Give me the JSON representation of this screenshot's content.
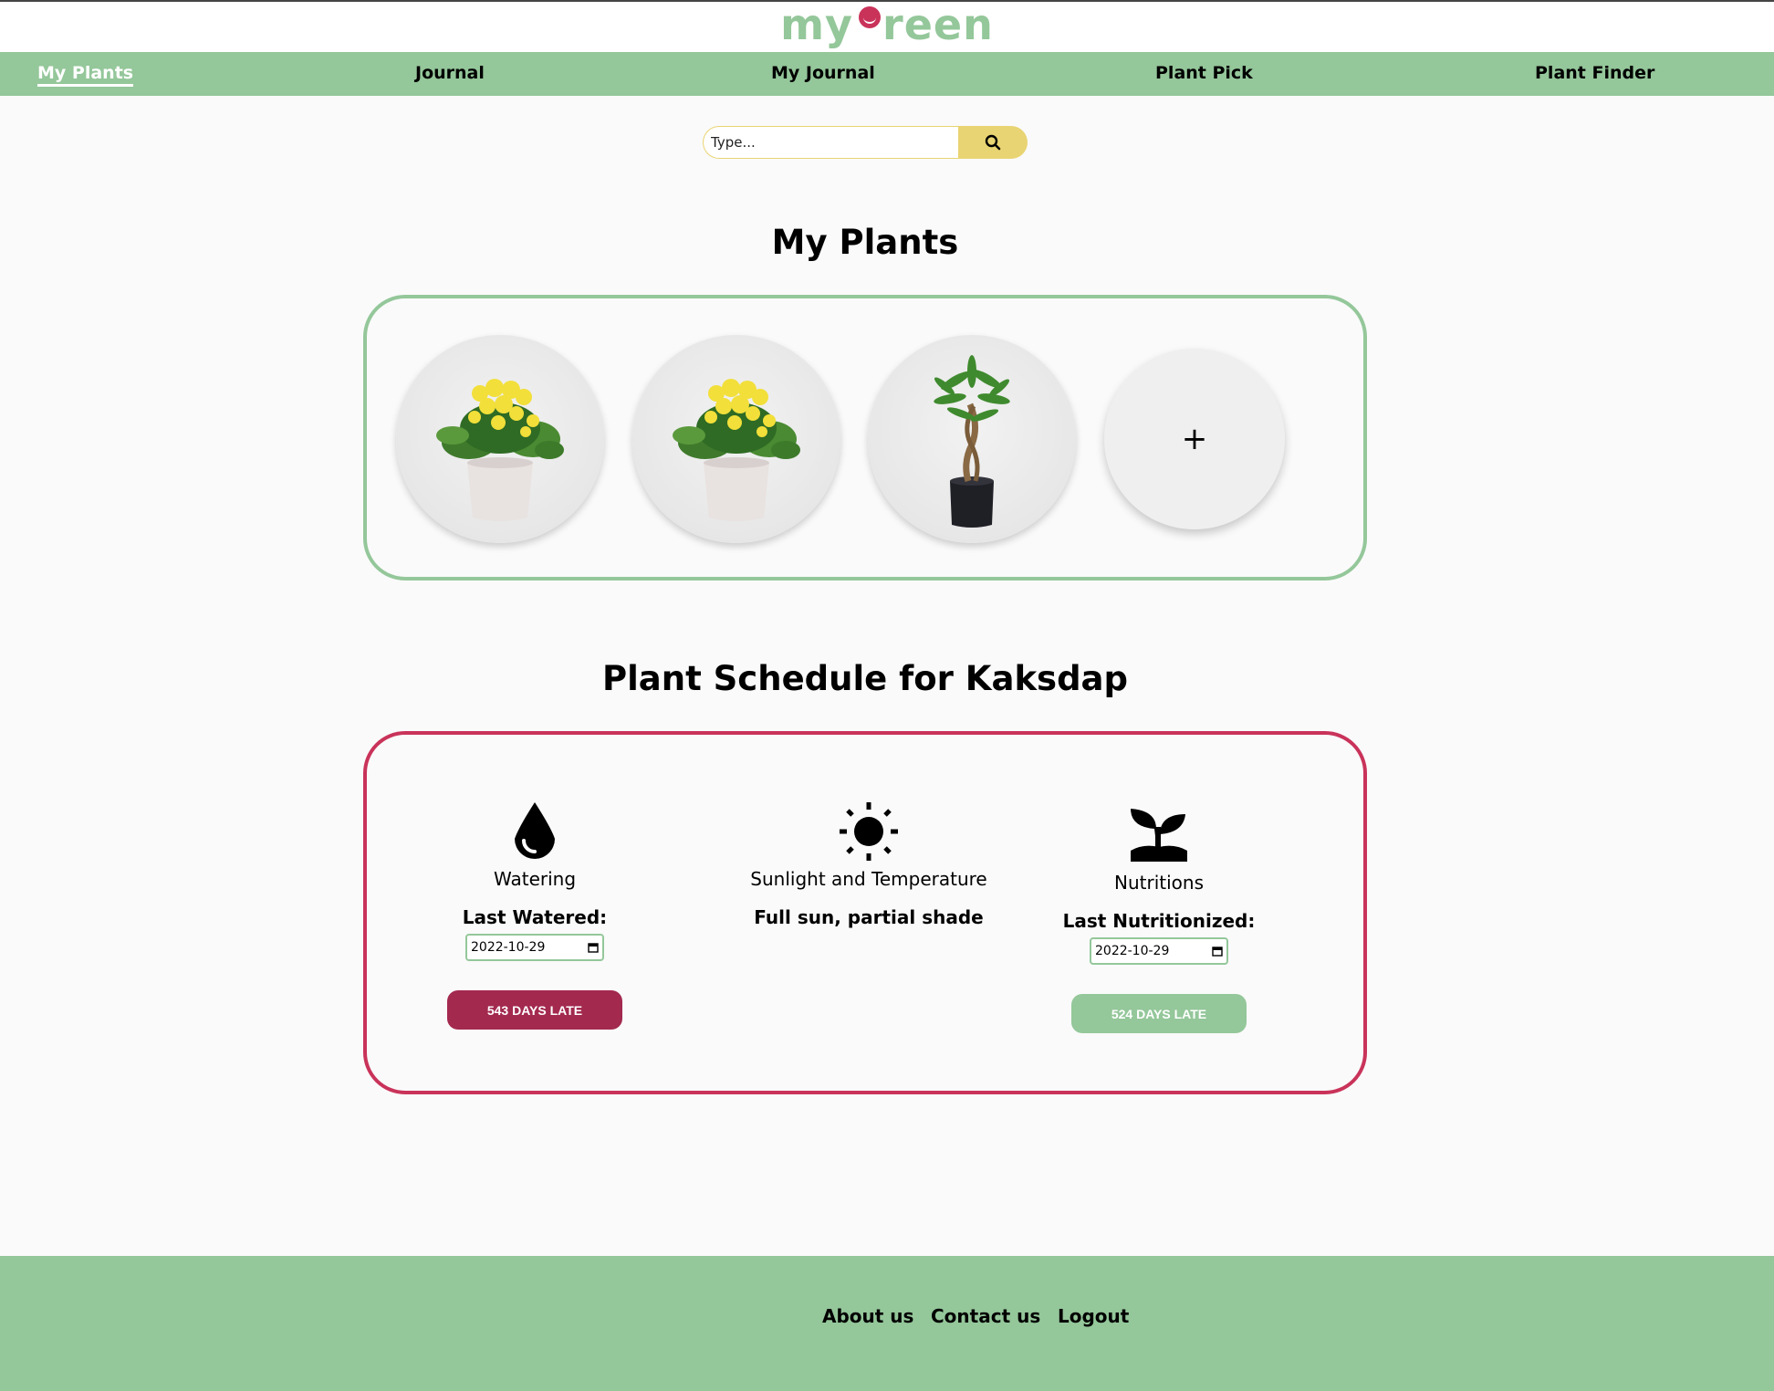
{
  "app": {
    "logo": {
      "left": "my",
      "right": "reen"
    }
  },
  "nav": {
    "items": [
      {
        "label": "My Plants",
        "active": true
      },
      {
        "label": "Journal"
      },
      {
        "label": "My Journal"
      },
      {
        "label": "Plant Pick"
      },
      {
        "label": "Plant Finder"
      }
    ]
  },
  "search": {
    "placeholder": "Type...",
    "icon": "search-icon"
  },
  "my_plants": {
    "title": "My Plants",
    "plants": [
      {
        "icon": "yellow-flower-plant"
      },
      {
        "icon": "yellow-flower-plant"
      },
      {
        "icon": "money-tree-plant"
      }
    ],
    "add_label": "+"
  },
  "schedule": {
    "title": "Plant Schedule for Kaksdap",
    "watering": {
      "label": "Watering",
      "sub_label": "Last Watered:",
      "date": "2022-10-29",
      "status": "543 DAYS LATE",
      "status_color": "#a3294f",
      "icon": "water-drop-icon"
    },
    "sunlight": {
      "label": "Sunlight and Temperature",
      "value": "Full sun, partial shade",
      "icon": "sun-icon"
    },
    "nutrition": {
      "label": "Nutritions",
      "sub_label": "Last Nutritionized:",
      "date": "2022-10-29",
      "status": "524 DAYS LATE",
      "status_color": "#94c79a",
      "icon": "seedling-icon"
    }
  },
  "footer": {
    "links": [
      "About us",
      "Contact us",
      "Logout"
    ]
  },
  "colors": {
    "brand_green": "#94c79a",
    "accent_red": "#c9335a",
    "search_yellow": "#e8d472"
  }
}
